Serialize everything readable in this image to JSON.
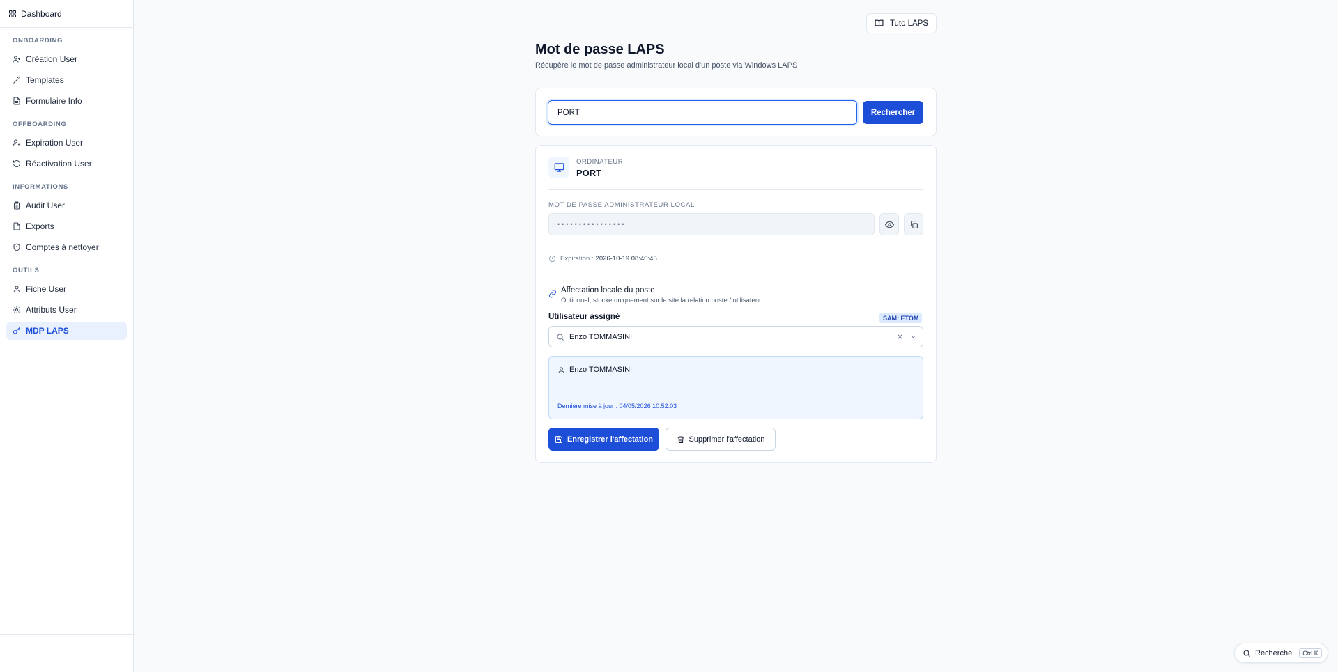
{
  "sidebar": {
    "dashboard": "Dashboard",
    "sections": [
      {
        "title": "ONBOARDING",
        "items": [
          "Création User",
          "Templates",
          "Formulaire Info"
        ]
      },
      {
        "title": "OFFBOARDING",
        "items": [
          "Expiration User",
          "Réactivation User"
        ]
      },
      {
        "title": "INFORMATIONS",
        "items": [
          "Audit User",
          "Exports",
          "Comptes à nettoyer"
        ]
      },
      {
        "title": "OUTILS",
        "items": [
          "Fiche User",
          "Attributs User",
          "MDP LAPS"
        ]
      }
    ],
    "active_item": "MDP LAPS"
  },
  "header": {
    "tuto_label": "Tuto LAPS",
    "title": "Mot de passe LAPS",
    "subtitle": "Récupère le mot de passe administrateur local d'un poste via Windows LAPS"
  },
  "search": {
    "value": "PORT",
    "button_label": "Rechercher"
  },
  "result": {
    "computer_label": "ORDINATEUR",
    "computer_name": "PORT",
    "password_label": "MOT DE PASSE ADMINISTRATEUR LOCAL",
    "password_masked": "••••••••••••••••",
    "expiration_label": "Expiration :",
    "expiration_value": "2026-10-19 08:40:45"
  },
  "assignment": {
    "title": "Affectation locale du poste",
    "subtitle": "Optionnel, stocke uniquement sur le site la relation poste / utilisateur.",
    "assigned_label": "Utilisateur assigné",
    "sam_badge": "SAM: ETOM",
    "select_value": "Enzo TOMMASINI",
    "user_name": "Enzo TOMMASINI",
    "last_update": "Dernière mise à jour : 04/05/2026 10:52:03",
    "save_label": "Enregistrer l'affectation",
    "delete_label": "Supprimer l'affectation"
  },
  "command_palette": {
    "label": "Recherche",
    "shortcut": "Ctrl K"
  },
  "colors": {
    "accent": "#1d4ed8",
    "active_bg": "#e8f1fd",
    "info_bg": "#eff6ff"
  }
}
